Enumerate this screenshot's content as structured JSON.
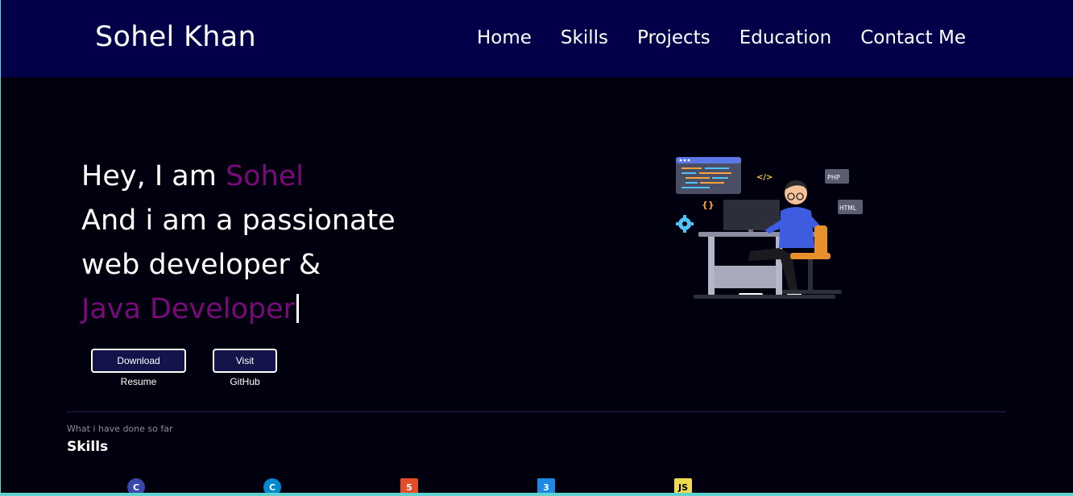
{
  "brand": "Sohel Khan",
  "nav": [
    "Home",
    "Skills",
    "Projects",
    "Education",
    "Contact Me"
  ],
  "hero": {
    "line1_prefix": "Hey, I am ",
    "line1_name": "Sohel",
    "line2": "And i am a passionate",
    "line3": "web developer &",
    "typed_role": "Java Developer"
  },
  "buttons": {
    "resume": "Download Resume",
    "github": "Visit GitHub"
  },
  "illustration": {
    "tag_code": "</>",
    "tag_php": "PHP",
    "tag_html": "HTML",
    "tag_braces": "{}"
  },
  "skills": {
    "subheading": "What i have done so far",
    "title": "Skills",
    "icons": [
      {
        "name": "c-icon",
        "glyph": "C",
        "color": "#3949ab"
      },
      {
        "name": "cpp-icon",
        "glyph": "C",
        "color": "#0288d1"
      },
      {
        "name": "html5-icon",
        "glyph": "5",
        "color": "#e44d26"
      },
      {
        "name": "css3-icon",
        "glyph": "3",
        "color": "#1e88e5"
      },
      {
        "name": "js-icon",
        "glyph": "JS",
        "color": "#f0db4f"
      }
    ]
  },
  "colors": {
    "navbar": "#03004a",
    "background": "#01000f",
    "accent": "#7a0a7a",
    "button": "#14144a"
  }
}
